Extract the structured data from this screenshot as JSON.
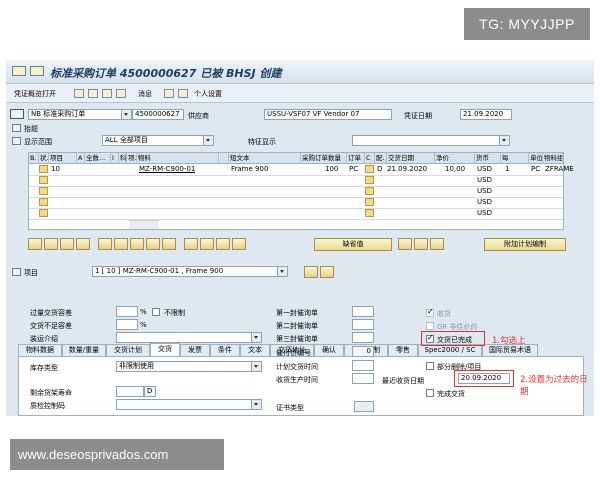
{
  "watermark_top": "TG: MYYJJPP",
  "watermark_bottom": "www.deseosprivados.com",
  "title": "标准采购订单 4500000627 已被 BHSJ 创建",
  "toolbar": {
    "doc_overview": "凭证概览打开",
    "messages": "消息",
    "personal_settings": "个人设置"
  },
  "header": {
    "doc_type": "NB 标准采购订单",
    "po_number": "4500000627",
    "vendor_label": "供应商",
    "vendor": "USSU-VSF07 VF Vendor 07",
    "doc_date_label": "凭证日期",
    "doc_date": "21.09.2020",
    "header_label": "抬题",
    "display_range_label": "显示范围",
    "display_range": "ALL 全部项目",
    "special_display_label": "特征显示"
  },
  "grid": {
    "columns": [
      "B.",
      "状.",
      "项目",
      "A",
      "全数...",
      "I",
      "科",
      "项.",
      "物料",
      "",
      "短文本",
      "采购订单数量",
      "订单",
      "C",
      "配.",
      "交货日期",
      "净价",
      "货币",
      "每",
      "单位",
      "物料组"
    ],
    "row1": {
      "item": "10",
      "material": "MZ-RM-C900-01",
      "short_text": "Frame 900",
      "quantity": "100",
      "unit": "PC",
      "cat": "D",
      "delivery_date": "21.09.2020",
      "net_price": "10,00",
      "currency": "USD",
      "per": "1",
      "order_unit": "PC",
      "mat_group": "ZFRAME"
    },
    "extra_currency": [
      "USD",
      "USD",
      "USD",
      "USD"
    ]
  },
  "buttons": {
    "default_values": "缺省值",
    "add_planning": "附加计划编制"
  },
  "item_section": {
    "label": "项目",
    "value": "1 [ 10 ] MZ-RM-C900-01 , Frame 900"
  },
  "tabs": [
    "物料数据",
    "数量/重量",
    "交货计划",
    "交货",
    "发票",
    "条件",
    "文本",
    "交货地址",
    "确认",
    "条件控制",
    "零售",
    "Spec2000 / SC",
    "国际贸易术语"
  ],
  "delivery": {
    "overdelivery_tol": "过量交货容差",
    "underdelivery_tol": "交货不足容差",
    "shipping_instr": "装运介绍",
    "stock_type": "库存类型",
    "stock_type_value": "非限制使用",
    "remaining_shelf": "剩余货架寿命",
    "qm_control": "质检控制码",
    "unlimited": "不限制",
    "percent": "%",
    "remaining_unit": "D",
    "reminder1": "第一封催询单",
    "reminder2": "第二封催询单",
    "reminder3": "第三封催询单",
    "reminder_no": "催付信编号",
    "reminder_no_value": "0",
    "planned_delivery": "计划交货时间",
    "gr_processing": "收货生产时间",
    "cert_type": "证书类型",
    "goods_receipt": "收货",
    "gr_non_valuated": "GR 非估价的",
    "delivery_completed": "交货已完成",
    "partial_delete": "部分删除/项目",
    "last_delivery_date_label": "最近收货日期",
    "last_delivery_date": "20.09.2020",
    "final_delivery": "完成交货"
  },
  "annotations": {
    "note1": "1.勾选上",
    "note2a": "2.设置为过去的日",
    "note2b": "期"
  },
  "colors": {
    "annotation_red": "#e03131",
    "title_blue": "#1f3d64"
  }
}
